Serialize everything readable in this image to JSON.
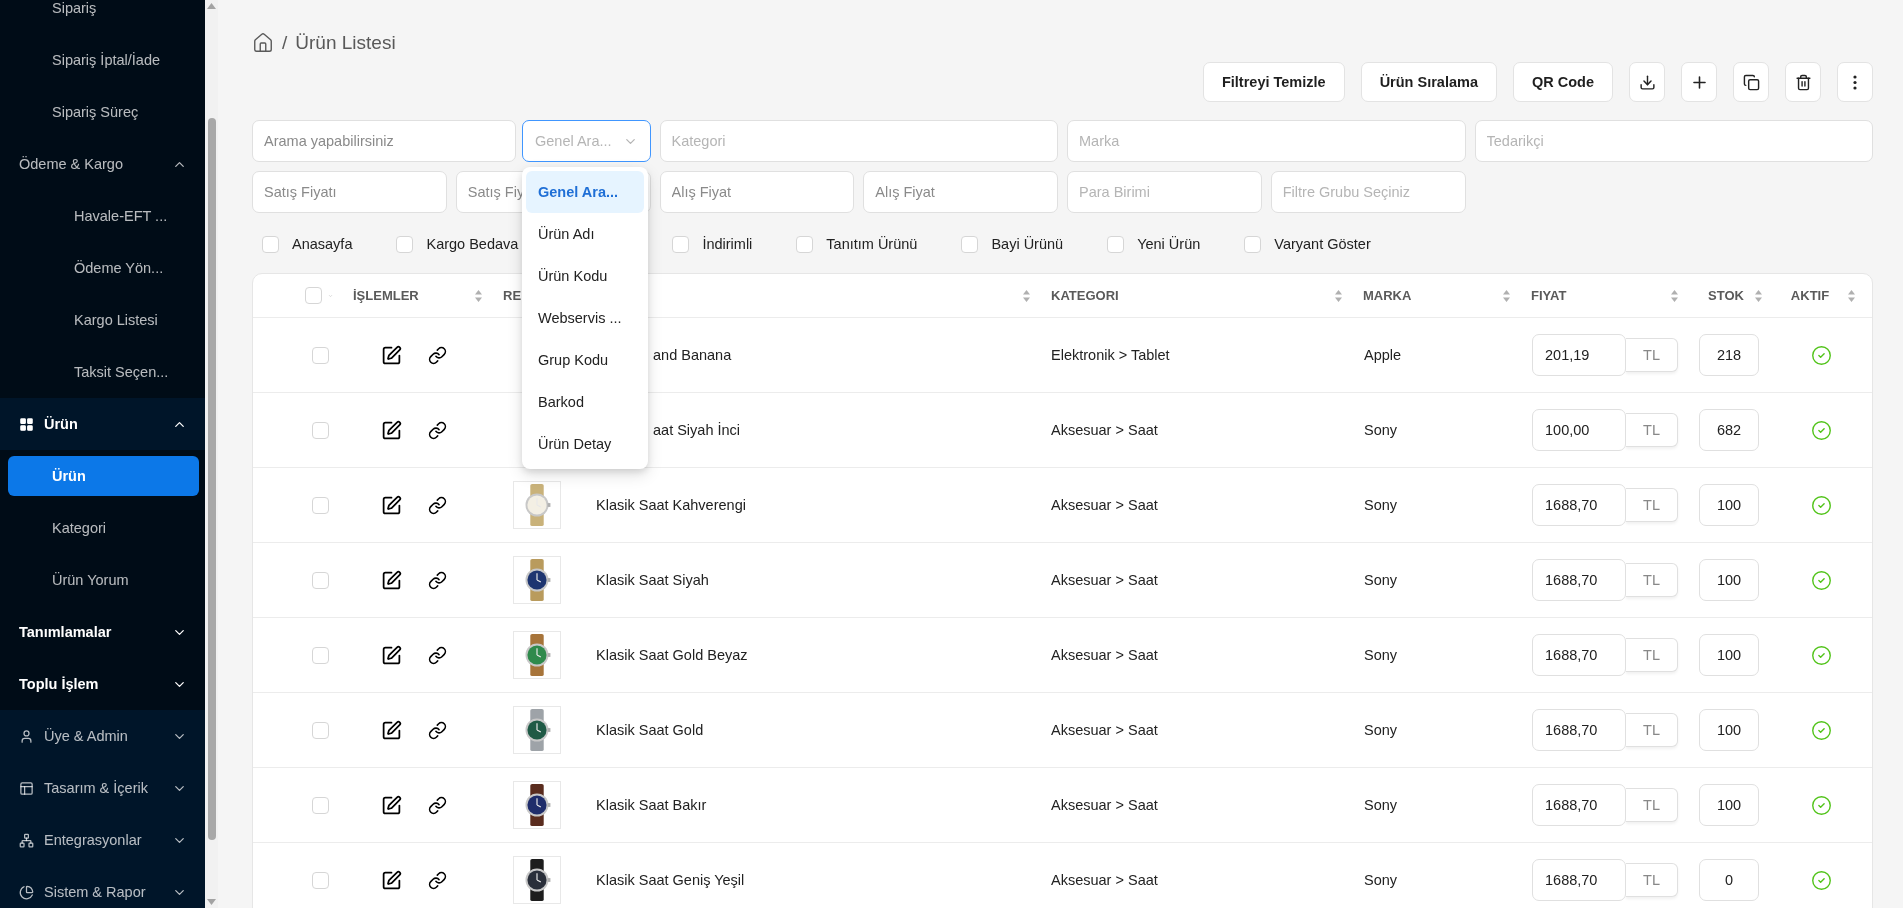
{
  "sidebar": {
    "items": [
      {
        "label": "Sipariş",
        "kind": "leaf",
        "selected": false
      },
      {
        "label": "Sipariş İptal/İade",
        "kind": "leaf",
        "selected": false
      },
      {
        "label": "Sipariş Süreç",
        "kind": "leaf",
        "selected": false
      },
      {
        "label": "Ödeme & Kargo",
        "kind": "submenu",
        "expanded": true,
        "children": [
          {
            "label": "Havale-EFT ...",
            "kind": "leaf",
            "selected": false
          },
          {
            "label": "Ödeme Yön...",
            "kind": "leaf",
            "selected": false
          },
          {
            "label": "Kargo Listesi",
            "kind": "leaf",
            "selected": false
          },
          {
            "label": "Taksit Seçen...",
            "kind": "leaf",
            "selected": false
          }
        ]
      },
      {
        "label": "Ürün",
        "kind": "grid",
        "expanded": true,
        "children": [
          {
            "label": "Ürün",
            "kind": "leaf",
            "selected": true
          },
          {
            "label": "Kategori",
            "kind": "leaf",
            "selected": false
          },
          {
            "label": "Ürün Yorum",
            "kind": "leaf",
            "selected": false
          }
        ]
      },
      {
        "label": "Tanımlamalar",
        "kind": "section",
        "expanded": false
      },
      {
        "label": "Toplu İşlem",
        "kind": "section",
        "expanded": false
      },
      {
        "label": "Üye & Admin",
        "kind": "user",
        "expanded": false
      },
      {
        "label": "Tasarım & İçerik",
        "kind": "layout",
        "expanded": false
      },
      {
        "label": "Entegrasyonlar",
        "kind": "network",
        "expanded": false
      },
      {
        "label": "Sistem & Rapor",
        "kind": "chart",
        "expanded": false
      }
    ]
  },
  "breadcrumb": {
    "separator": "/",
    "current": "Ürün Listesi"
  },
  "toolbar": {
    "buttons": [
      "Filtreyi Temizle",
      "Ürün Sıralama",
      "QR Code"
    ],
    "icon_buttons": [
      {
        "kind": "download"
      },
      {
        "kind": "add"
      },
      {
        "kind": "copy"
      },
      {
        "kind": "delete"
      },
      {
        "kind": "more"
      }
    ]
  },
  "filters": {
    "search": {
      "placeholder": "Arama yapabilirsiniz"
    },
    "search_mode": {
      "value": "Genel Ara...",
      "open": true,
      "options": [
        {
          "label": "Genel Ara...",
          "selected": true
        },
        {
          "label": "Ürün Adı",
          "selected": false
        },
        {
          "label": "Ürün Kodu",
          "selected": false
        },
        {
          "label": "Webservis ...",
          "selected": false
        },
        {
          "label": "Grup Kodu",
          "selected": false
        },
        {
          "label": "Barkod",
          "selected": false
        },
        {
          "label": "Ürün Detay",
          "selected": false
        }
      ]
    },
    "row_1": [
      {
        "placeholder": "Kategori"
      },
      {
        "placeholder": "Marka"
      },
      {
        "placeholder": "Tedarikçi"
      }
    ],
    "row_2": [
      {
        "placeholder": "Satış Fiyatı"
      },
      {
        "placeholder": "Satış Fiy"
      },
      {
        "placeholder": "Alış Fiyat"
      },
      {
        "placeholder": "Alış Fiyat"
      },
      {
        "placeholder": "Para Birimi"
      },
      {
        "placeholder": "Filtre Grubu Seçiniz"
      }
    ],
    "checkboxes": [
      {
        "label": "Anasayfa",
        "checked": false,
        "covered": false
      },
      {
        "label": "Kargo Bedava",
        "checked": false,
        "covered": true
      },
      {
        "label": "İndirimli",
        "checked": false,
        "covered": false
      },
      {
        "label": "Tanıtım Ürünü",
        "checked": false,
        "covered": false
      },
      {
        "label": "Bayi Ürünü",
        "checked": false,
        "covered": false
      },
      {
        "label": "Yeni Ürün",
        "checked": false,
        "covered": false
      },
      {
        "label": "Varyant Göster",
        "checked": false,
        "covered": false
      }
    ]
  },
  "table": {
    "select_all": {
      "checked": false
    },
    "columns": [
      "İŞLEMLER",
      "RE",
      "KATEGORI",
      "MARKA",
      "FIYAT",
      "STOK",
      "AKTIF"
    ],
    "rows": [
      {
        "covered": true,
        "name": "and Banana",
        "category": "Elektronik > Tablet",
        "brand": "Apple",
        "price": "201,19",
        "currency": "TL",
        "stock": "218",
        "active": true,
        "checked": false
      },
      {
        "covered": true,
        "name": "aat Siyah İnci",
        "category": "Aksesuar > Saat",
        "brand": "Sony",
        "price": "100,00",
        "currency": "TL",
        "stock": "682",
        "active": true,
        "checked": false
      },
      {
        "covered": false,
        "name": "Klasik Saat Kahverengi",
        "category": "Aksesuar > Saat",
        "brand": "Sony",
        "price": "1688,70",
        "currency": "TL",
        "stock": "100",
        "active": true,
        "checked": false
      },
      {
        "covered": false,
        "name": "Klasik Saat Siyah",
        "category": "Aksesuar > Saat",
        "brand": "Sony",
        "price": "1688,70",
        "currency": "TL",
        "stock": "100",
        "active": true,
        "checked": false
      },
      {
        "covered": false,
        "name": "Klasik Saat Gold Beyaz",
        "category": "Aksesuar > Saat",
        "brand": "Sony",
        "price": "1688,70",
        "currency": "TL",
        "stock": "100",
        "active": true,
        "checked": false
      },
      {
        "covered": false,
        "name": "Klasik Saat Gold",
        "category": "Aksesuar > Saat",
        "brand": "Sony",
        "price": "1688,70",
        "currency": "TL",
        "stock": "100",
        "active": true,
        "checked": false
      },
      {
        "covered": false,
        "name": "Klasik Saat Bakır",
        "category": "Aksesuar > Saat",
        "brand": "Sony",
        "price": "1688,70",
        "currency": "TL",
        "stock": "100",
        "active": true,
        "checked": false
      },
      {
        "covered": false,
        "name": "Klasik Saat Geniş Yeşil",
        "category": "Aksesuar > Saat",
        "brand": "Sony",
        "price": "1688,70",
        "currency": "TL",
        "stock": "0",
        "active": true,
        "checked": false
      }
    ]
  }
}
